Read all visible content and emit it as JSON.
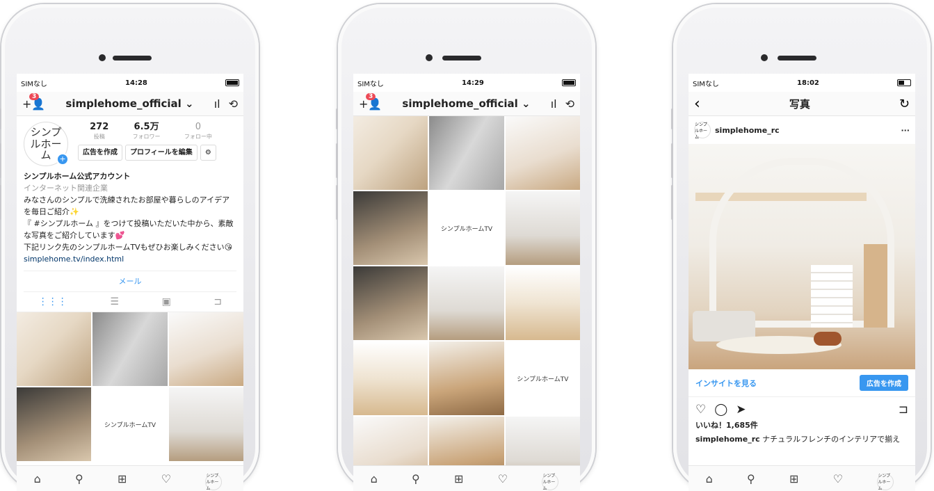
{
  "phone1": {
    "status": {
      "carrier": "SIMなし",
      "time": "14:28"
    },
    "header": {
      "username": "simplehome_official",
      "notification_count": "3"
    },
    "profile": {
      "avatar_text": "シンプルホーム",
      "stats": [
        {
          "value": "272",
          "label": "投稿"
        },
        {
          "value": "6.5万",
          "label": "フォロワー"
        },
        {
          "value": "0",
          "label": "フォロー中"
        }
      ],
      "ad_button": "広告を作成",
      "edit_button": "プロフィールを編集",
      "bio_name": "シンプルホーム公式アカウント",
      "bio_category": "インターネット関連企業",
      "bio_text_1": "みなさんのシンプルで洗練されたお部屋や暮らしのアイデアを毎日ご紹介✨",
      "bio_text_2": "『 #シンプルホーム 』をつけて投稿いただいた中から、素敵な写真をご紹介しています💕",
      "bio_text_3": "下記リンク先のシンプルホームTVもぜひお楽しみください😘",
      "bio_link": "simplehome.tv/index.html",
      "mail_button": "メール"
    },
    "grid_tv_label": "シンプルホームTV"
  },
  "phone2": {
    "status": {
      "carrier": "SIMなし",
      "time": "14:29"
    },
    "header": {
      "username": "simplehome_official",
      "notification_count": "3"
    },
    "grid_tv_label": "シンプルホームTV"
  },
  "phone3": {
    "status": {
      "carrier": "SIMなし",
      "time": "18:02"
    },
    "header": {
      "title": "写真"
    },
    "post": {
      "avatar_text": "シンプルホーム",
      "username": "simplehome_rc",
      "insight_link": "インサイトを見る",
      "ad_button": "広告を作成",
      "likes": "いいね！1,685件",
      "caption_user": "simplehome_rc",
      "caption_text": "ナチュラルフレンチのインテリアで揃え"
    }
  },
  "icons": {
    "home": "⌂",
    "search": "⚲",
    "add": "⊞",
    "heart": "♡",
    "comment": "◯",
    "send": "➤",
    "bookmark": "⊐",
    "stats": "ıl",
    "history": "⟲",
    "settings": "⚙",
    "back": "‹",
    "refresh": "↻",
    "more": "···",
    "grid": "⋮⋮⋮",
    "list": "☰",
    "tagged": "▣",
    "add_user": "+👤",
    "camera": "▢"
  },
  "colors": {
    "accent": "#3897f0",
    "badge": "#ed4956"
  }
}
